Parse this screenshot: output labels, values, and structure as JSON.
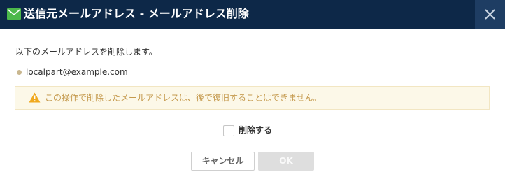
{
  "dialog": {
    "title": "送信元メールアドレス - メールアドレス削除",
    "title_icon": "envelope-icon",
    "close_icon": "close-icon",
    "message": "以下のメールアドレスを削除します。",
    "address": "localpart@example.com",
    "warning": {
      "icon": "warning-icon",
      "text": "この操作で削除したメールアドレスは、後で復旧することはできません。"
    },
    "confirm_checkbox": {
      "label": "削除する",
      "checked": false
    },
    "buttons": {
      "cancel": "キャンセル",
      "ok": "OK",
      "ok_enabled": false
    }
  },
  "colors": {
    "titlebar_bg": "#0d2848",
    "close_bg": "#1e3d63",
    "title_icon": "#4cb84a",
    "warning_bg": "#fcf8e8",
    "warning_text": "#c59a4e",
    "warning_icon": "#f0a91e"
  }
}
